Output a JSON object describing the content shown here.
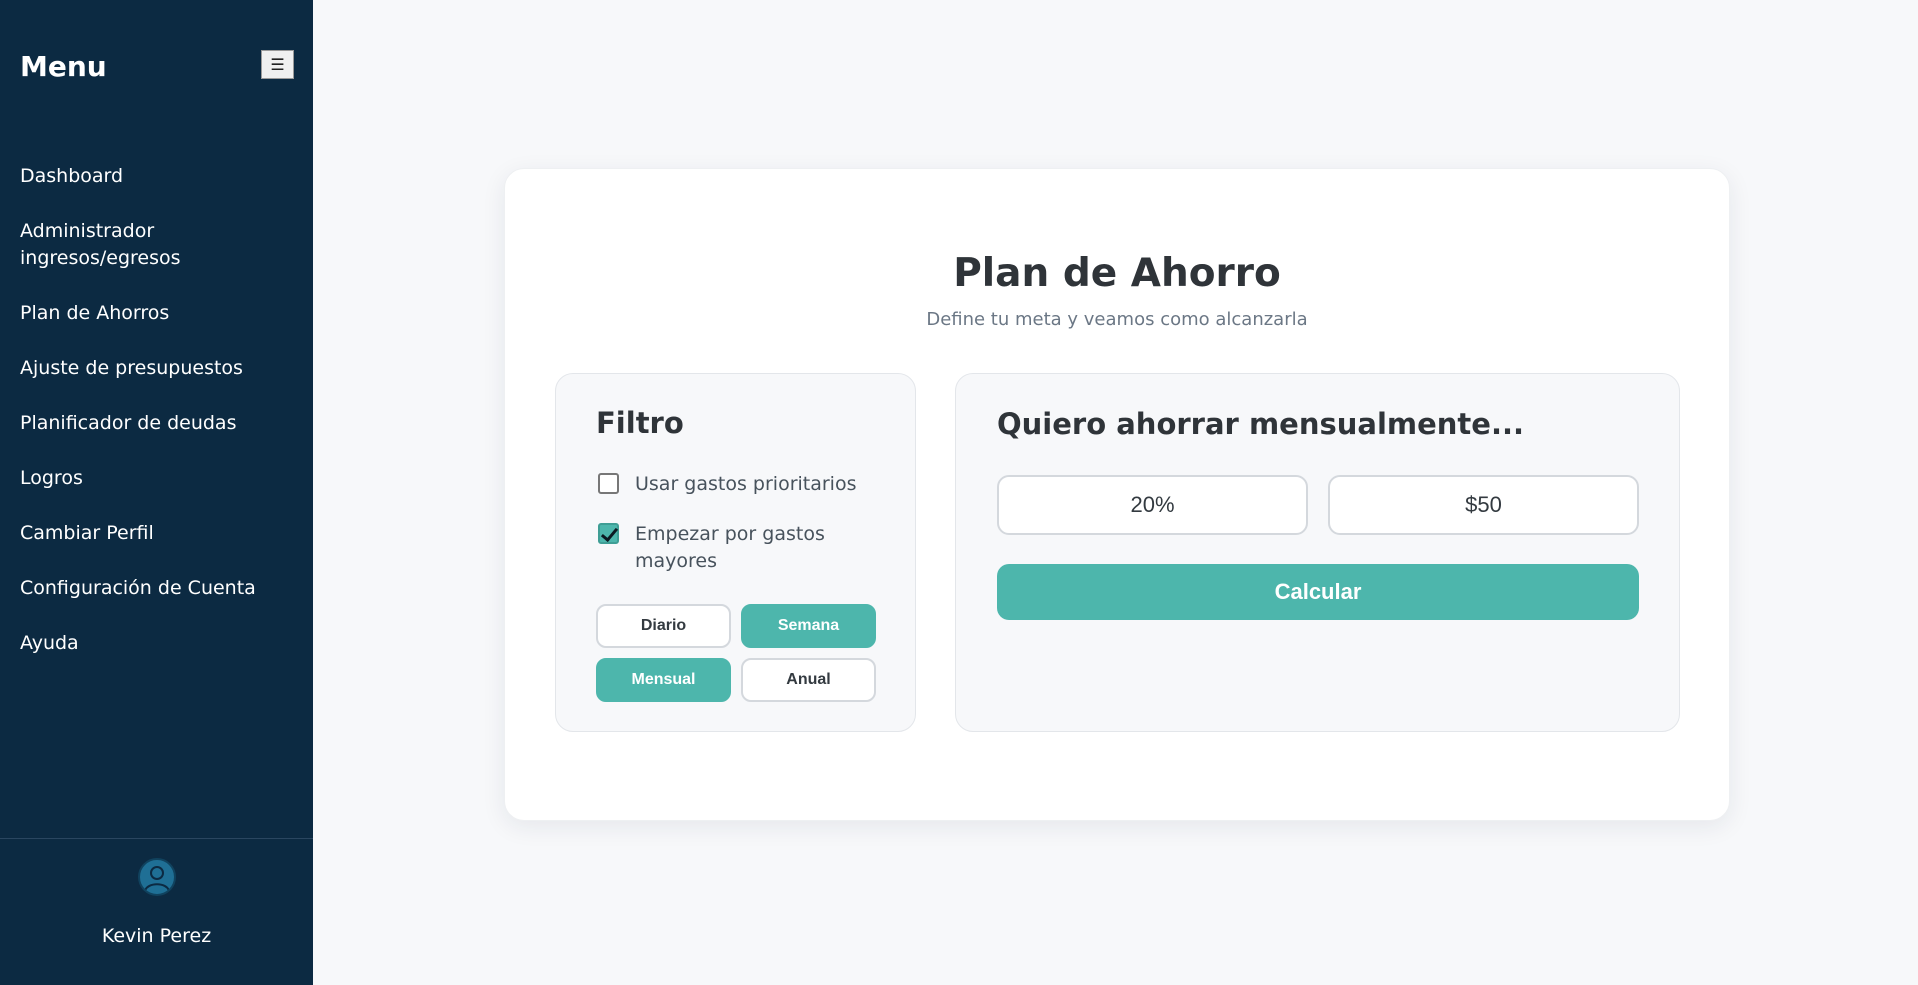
{
  "sidebar": {
    "title": "Menu",
    "toggle_label": "☰",
    "items": [
      {
        "label": "Dashboard"
      },
      {
        "label": "Administrador ingresos/egresos"
      },
      {
        "label": "Plan de Ahorros"
      },
      {
        "label": "Ajuste de presupuestos"
      },
      {
        "label": "Planificador de deudas"
      },
      {
        "label": "Logros"
      },
      {
        "label": "Cambiar Perfil"
      },
      {
        "label": "Configuración de Cuenta"
      },
      {
        "label": "Ayuda"
      }
    ],
    "user": {
      "name": "Kevin Perez",
      "avatar_icon": "user-avatar-icon"
    }
  },
  "main": {
    "title": "Plan de Ahorro",
    "subtitle": "Define tu meta y veamos como alcanzarla",
    "filter": {
      "title": "Filtro",
      "options": [
        {
          "label": "Usar gastos prioritarios",
          "checked": false
        },
        {
          "label": "Empezar por gastos mayores",
          "checked": true
        }
      ],
      "periods": [
        {
          "label": "Diario",
          "selected": false
        },
        {
          "label": "Semana",
          "selected": true
        },
        {
          "label": "Mensual",
          "selected": true
        },
        {
          "label": "Anual",
          "selected": false
        }
      ]
    },
    "savings": {
      "title": "Quiero ahorrar mensualmente...",
      "percent_value": "20%",
      "amount_value": "$50",
      "calculate_label": "Calcular"
    }
  },
  "colors": {
    "sidebar_bg": "#0c2a42",
    "accent": "#4db6ac",
    "page_bg": "#f7f8fa"
  }
}
